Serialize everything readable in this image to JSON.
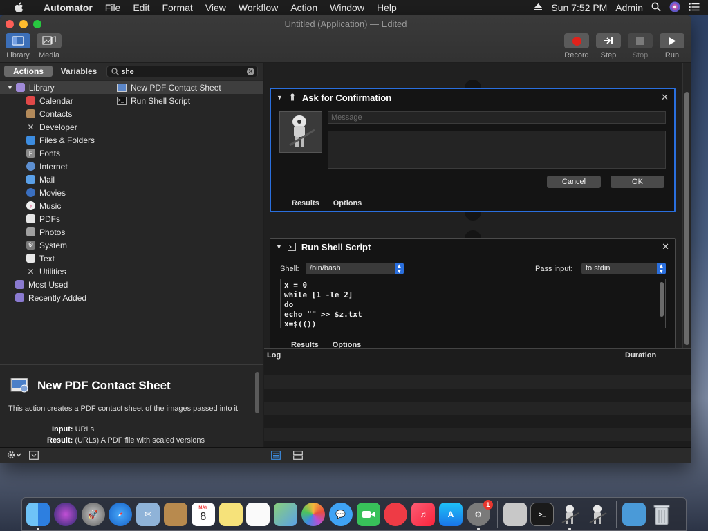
{
  "menubar": {
    "app_name": "Automator",
    "items": [
      "File",
      "Edit",
      "Format",
      "View",
      "Workflow",
      "Action",
      "Window",
      "Help"
    ],
    "clock": "Sun 7:52 PM",
    "user": "Admin"
  },
  "window": {
    "title": "Untitled (Application) — Edited",
    "toolbar": {
      "library": "Library",
      "media": "Media",
      "record": "Record",
      "step": "Step",
      "stop": "Stop",
      "run": "Run"
    }
  },
  "left": {
    "tabs": {
      "actions": "Actions",
      "variables": "Variables"
    },
    "search": {
      "value": "she"
    },
    "library_root": "Library",
    "categories": [
      "Calendar",
      "Contacts",
      "Developer",
      "Files & Folders",
      "Fonts",
      "Internet",
      "Mail",
      "Movies",
      "Music",
      "PDFs",
      "Photos",
      "System",
      "Text",
      "Utilities"
    ],
    "smart_groups": [
      "Most Used",
      "Recently Added"
    ],
    "results": [
      "New PDF Contact Sheet",
      "Run Shell Script"
    ],
    "description": {
      "title": "New PDF Contact Sheet",
      "text": "This action creates a PDF contact sheet of the images passed into it.",
      "input_label": "Input:",
      "input_value": "URLs",
      "result_label": "Result:",
      "result_value": "(URLs) A PDF file with scaled versions"
    }
  },
  "workflow": {
    "confirm": {
      "title": "Ask for Confirmation",
      "message_placeholder": "Message",
      "cancel": "Cancel",
      "ok": "OK",
      "tab_results": "Results",
      "tab_options": "Options"
    },
    "shell": {
      "title": "Run Shell Script",
      "shell_label": "Shell:",
      "shell_value": "/bin/bash",
      "pass_label": "Pass input:",
      "pass_value": "to stdin",
      "script_lines": [
        "x = 0",
        "while [1 -le 2]",
        "do",
        "echo \"\" >> $z.txt",
        "x=$(())"
      ],
      "tab_results": "Results",
      "tab_options": "Options"
    }
  },
  "log": {
    "col_log": "Log",
    "col_duration": "Duration"
  },
  "dock": {
    "calendar_day": "8",
    "calendar_month": "MAY",
    "app_store_badge": "1"
  }
}
